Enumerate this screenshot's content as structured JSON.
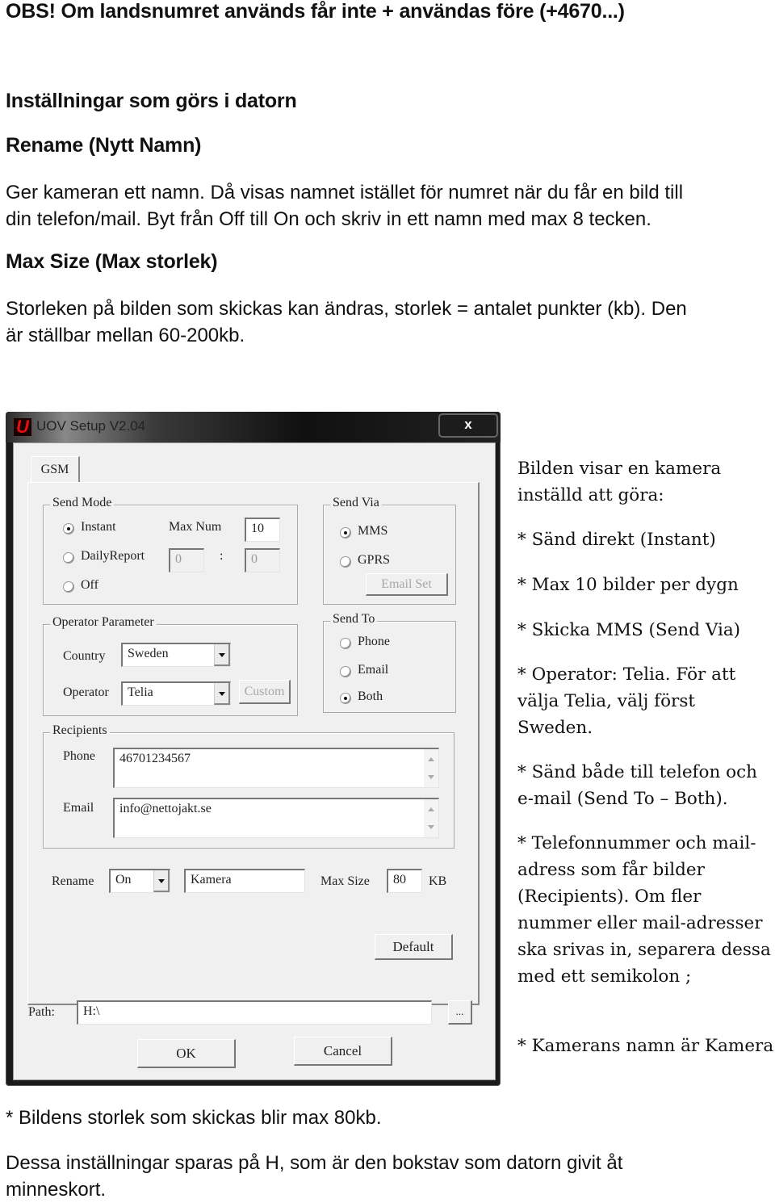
{
  "document": {
    "notice": "OBS! Om landsnumret används får inte + användas före (+4670...)",
    "heading_settings": "Inställningar som görs i datorn",
    "heading_rename": "Rename (Nytt Namn)",
    "rename_line1": "Ger kameran ett namn. Då visas namnet istället för numret när du får en bild till",
    "rename_line2": "din telefon/mail. Byt från Off till On och skriv in ett namn med max 8 tecken.",
    "heading_maxsize": "Max Size (Max storlek)",
    "maxsize_line1": "Storleken på bilden som skickas kan ändras, storlek = antalet punkter (kb). Den",
    "maxsize_line2": "är ställbar mellan 60-200kb.",
    "footnote_size": "* Bildens storlek som skickas blir max 80kb.",
    "footer_line1": "Dessa inställningar sparas på H, som är den bokstav som datorn givit åt",
    "footer_line2": "minneskort."
  },
  "sidebar_notes": {
    "intro": "Bilden visar en kamera inställd att göra:",
    "items": [
      "* Sänd direkt (Instant)",
      "* Max 10 bilder per dygn",
      "* Skicka MMS (Send Via)",
      "* Operator: Telia. För att välja Telia, välj först Sweden.",
      "* Sänd både till telefon och e-mail (Send To – Both).",
      "* Telefonnummer och mail-adress som får bilder (Recipients). Om fler nummer eller mail-adresser ska srivas in, separera dessa med ett semikolon ;",
      "* Kamerans namn är Kamera"
    ]
  },
  "dialog": {
    "title": "UOV Setup V2.04",
    "logo_letter": "U",
    "close_label": "x",
    "tab_label": "GSM",
    "send_mode": {
      "label": "Send Mode",
      "options": [
        "Instant",
        "DailyReport",
        "Off"
      ],
      "selected": "Instant",
      "max_num_label": "Max Num",
      "max_num_value": "10",
      "daily_hour": "0",
      "daily_sep": ":",
      "daily_minute": "0"
    },
    "send_via": {
      "label": "Send Via",
      "options": [
        "MMS",
        "GPRS"
      ],
      "selected": "MMS",
      "email_set_label": "Email Set"
    },
    "operator_parameter": {
      "label": "Operator Parameter",
      "country_label": "Country",
      "country_value": "Sweden",
      "operator_label": "Operator",
      "operator_value": "Telia",
      "custom_label": "Custom"
    },
    "send_to": {
      "label": "Send To",
      "options": [
        "Phone",
        "Email",
        "Both"
      ],
      "selected": "Both"
    },
    "recipients": {
      "label": "Recipients",
      "phone_label": "Phone",
      "phone_value": "46701234567",
      "email_label": "Email",
      "email_value": "info@nettojakt.se"
    },
    "rename": {
      "label": "Rename",
      "value": "On",
      "name_value": "Kamera",
      "max_size_label": "Max Size",
      "max_size_value": "80",
      "unit": "KB"
    },
    "default_label": "Default",
    "path_label": "Path:",
    "path_value": "H:\\",
    "browse_label": "...",
    "ok_label": "OK",
    "cancel_label": "Cancel"
  }
}
